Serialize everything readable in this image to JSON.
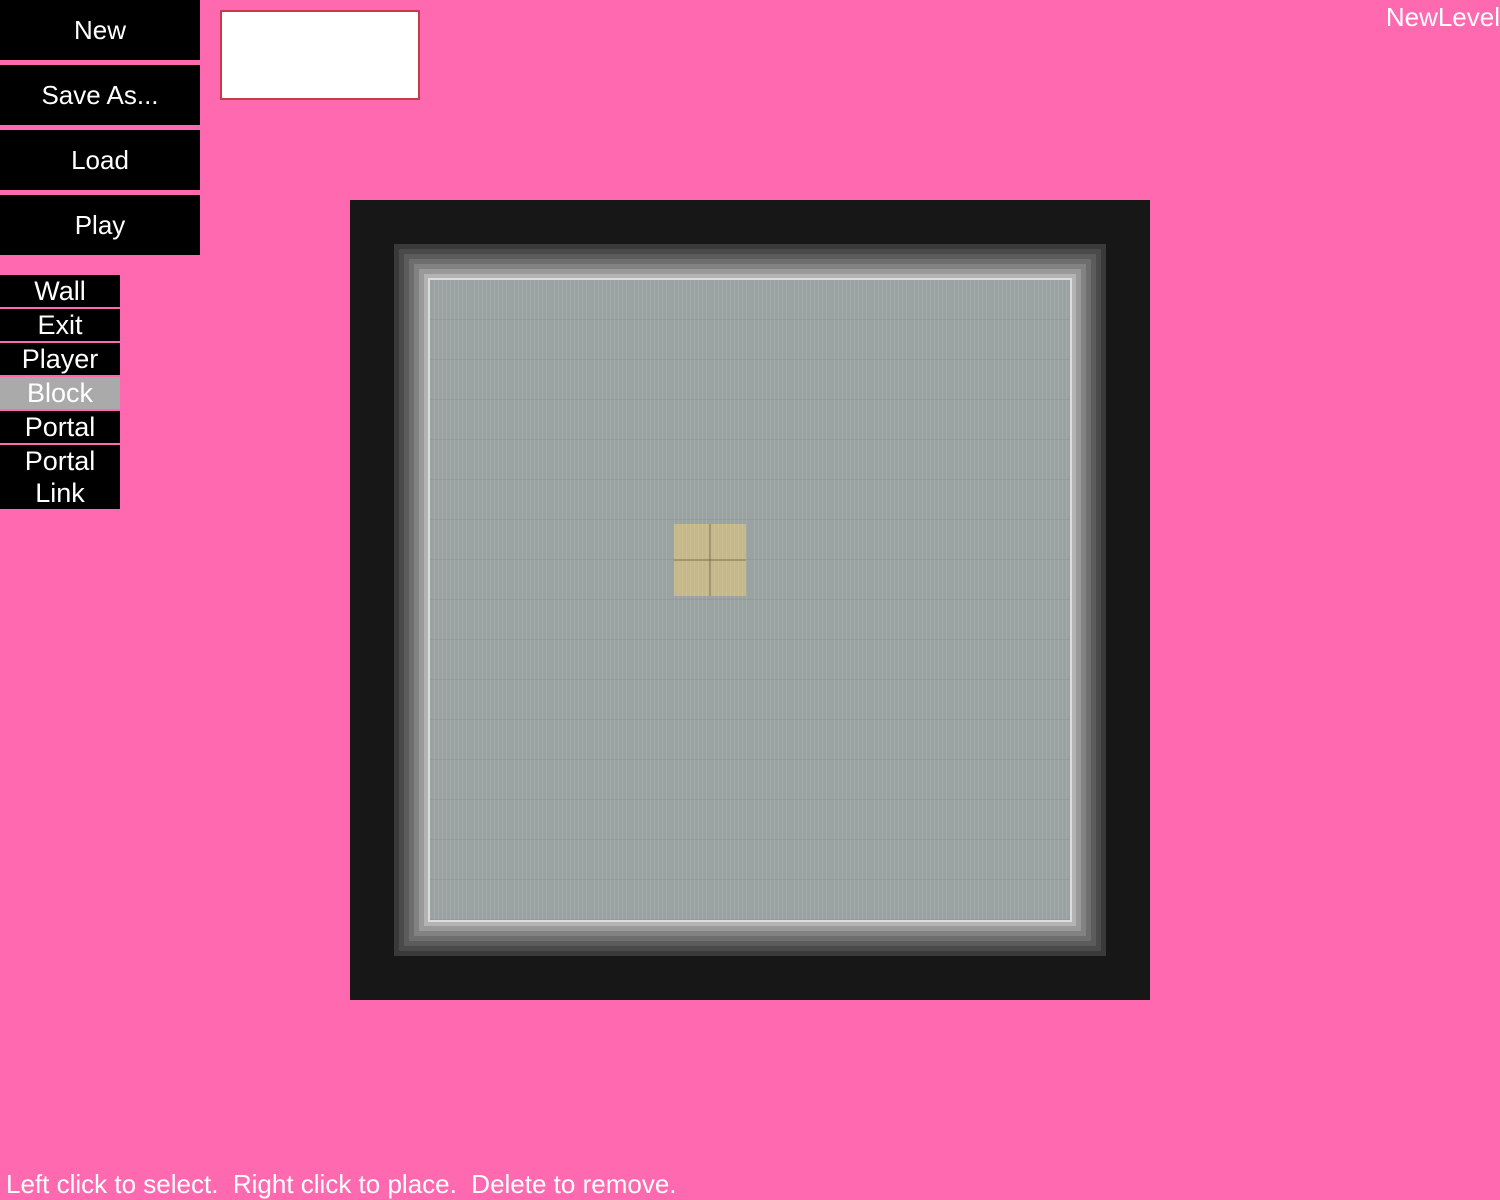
{
  "menu": {
    "new_label": "New",
    "save_as_label": "Save As...",
    "load_label": "Load",
    "play_label": "Play"
  },
  "tools": {
    "wall_label": "Wall",
    "exit_label": "Exit",
    "player_label": "Player",
    "block_label": "Block",
    "portal_label": "Portal",
    "portal_link_line1": "Portal",
    "portal_link_line2": "Link",
    "selected": "Block"
  },
  "level_name_input": {
    "value": ""
  },
  "level_name": "NewLevel",
  "board": {
    "columns": 16,
    "rows": 16,
    "blocks": [
      {
        "col": 6,
        "row": 6,
        "type": "Block"
      }
    ]
  },
  "status_text": "Left click to select.  Right click to place.  Delete to remove.",
  "colors": {
    "background": "#ff69b0",
    "button": "#000000",
    "button_selected": "#aaaaaa",
    "block": "#c6b88a",
    "floor": "#9aa3a2"
  }
}
